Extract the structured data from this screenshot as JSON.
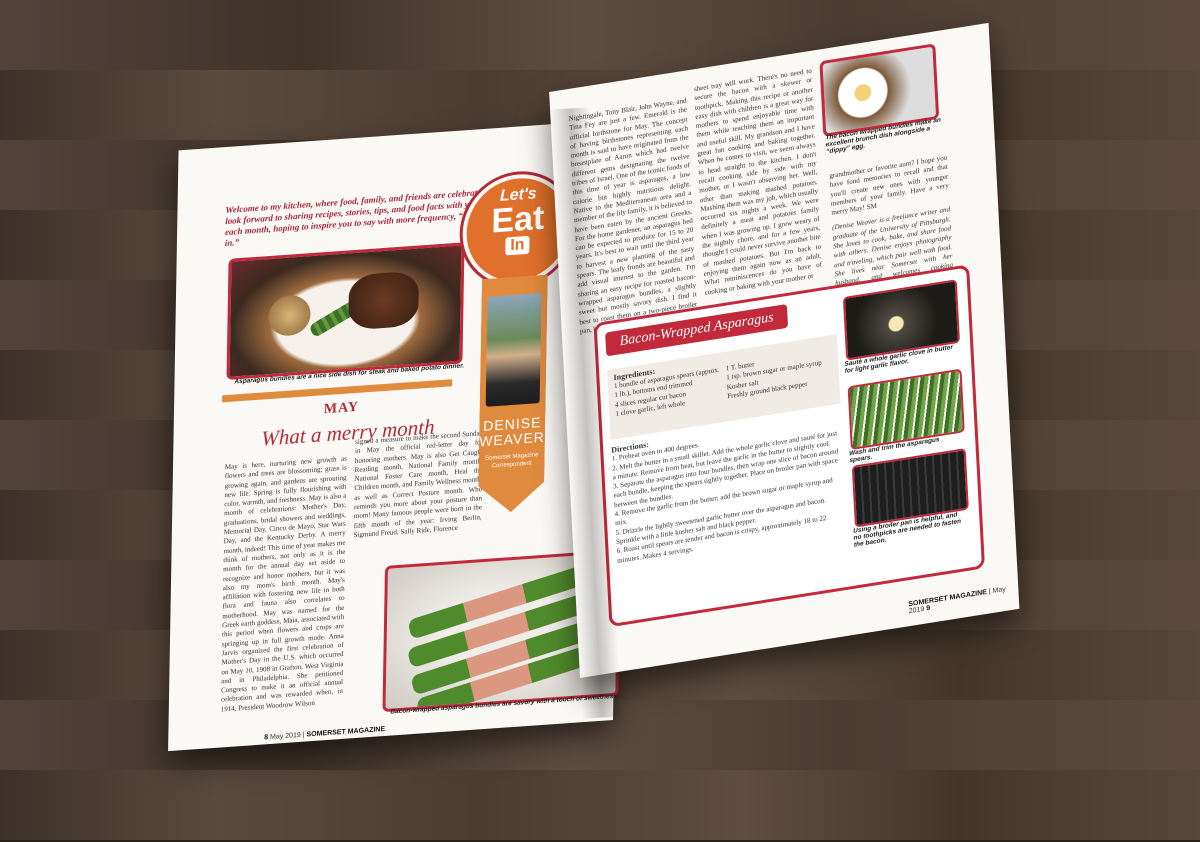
{
  "left_page": {
    "intro": "Welcome to my kitchen, where food, family, and friends are celebrated. I look forward to sharing recipes, stories, tips, and food facts with you each month, hoping to inspire you to say with more frequency, “Let’s eat in.”",
    "steak_caption": "Asparagus bundles are a nice side dish for steak and baked potato dinner.",
    "month": "MAY",
    "subtitle": "What a merry month",
    "col1": "May is here, nurturing new growth as flowers and trees are blossoming; grass is growing again, and gardens are sprouting new life. Spring is fully flourishing with color, warmth, and freshness. May is also a month of celebrations: Mother's Day, graduations, bridal showers and weddings, Memorial Day, Cinco de Mayo, Star Wars Day, and the Kentucky Derby. A merry month, indeed! This time of year makes me think of mothers, not only as it is the month for the annual day set aside to recognize and honor mothers, but it was also my mom's birth month. May's affiliation with fostering new life in both flora and fauna also correlates to motherhood. May was named for the Greek earth goddess, Maia, associated with this period when flowers and crops are springing up in full growth mode. Anna Jarvis organized the first celebration of Mother's Day in the U.S. which occurred on May 10, 1908 in Grafton, West Virginia and in Philadelphia. She petitioned Congress to make it an official annual celebration and was rewarded when, in 1914, President Woodrow Wilson",
    "col2": "signed a measure to make the second Sunday in May the official red-letter day for honoring mothers. May is also Get Caught Reading month, National Family month, National Foster Care month, Heal the Children month, and Family Wellness month, as well as Correct Posture month. Who reminds you more about your posture than mom! Many famous people were born in the fifth month of the year: Irving Berlin, Sigmund Freud, Sally Ride, Florence",
    "asparagus_caption": "Bacon-wrapped asparagus bundles are savory with a touch of sweetness.",
    "folio_number": "8",
    "folio_date": "May 2019",
    "folio_mag": "SOMERSET MAGAZINE"
  },
  "badge": {
    "lets": "Let's",
    "eat": "Eat",
    "in": "In"
  },
  "author": {
    "name": "DENISE WEAVER",
    "role": "Somerset Magazine Correspondent"
  },
  "right_page": {
    "col1": "Nightingale, Tony Blair, John Wayne, and Tina Fey are just a few. Emerald is the official birthstone for May. The concept of having birthstones representing each month is said to have originated from the breastplate of Aaron which had twelve different gems designating the twelve tribes of Israel. One of the iconic foods of this time of year is asparagus, a low calorie but highly nutritious delight. Native to the Mediterranean area and a member of the lily family, it is believed to have been eaten by the ancient Greeks. For the home gardener, an asparagus bed can be expected to produce for 15 to 20 years. It's best to wait until the third year to harvest a new planting of the tasty spears. The leafy fronds are beautiful and add visual interest to the garden. I'm sharing an easy recipe for roasted bacon-wrapped asparagus bundles, a slightly sweet but mostly savory dish. I find it best to roast them on a two-piece broiler pan, but a",
    "col2": "sheet tray will work. There's no need to secure the bacon with a skewer or toothpick. Making this recipe or another easy dish with children is a great way for mothers to spend enjoyable time with them while teaching them an important and useful skill. My grandson and I have great fun cooking and baking together. When he comes to visit, we seem always to head straight to the kitchen. I don't recall cooking side by side with my mother, or I wasn't observing her. Well, other than making mashed potatoes. Mashing them was my job, which usually occurred six nights a week. We were definitely a meat and potatoes family when I was growing up. I grew weary of the nightly chore, and for a few years, thought I could never survive another bite of mashed potatoes. But I'm back to enjoying them again now as an adult. What reminiscences do you have of cooking or baking with your mother or",
    "egg_caption": "The bacon wrapped bundles make an excellent brunch dish alongside a “dippy” egg.",
    "col3": "grandmother or favorite aunt? I hope you have fond memories to recall and that you'll create new ones with younger members of your family. Have a very merry May! SM",
    "bio": "(Denise Weaver is a freelance writer and graduate of the University of Pittsburgh. She loves to cook, bake, and share food with others. Denise enjoys photography and traveling, which pair well with food. She lives near Somerset with her husband, and welcomes cooking questions at quillshoppe@msn.com.)",
    "folio_mag": "SOMERSET MAGAZINE",
    "folio_date": "May 2019",
    "folio_number": "9"
  },
  "recipe": {
    "title": "Bacon-Wrapped Asparagus",
    "ingredients_head": "Ingredients:",
    "ingredients_a": [
      "1 bundle of asparagus spears (approx. 1 lb.), bottoms end trimmed",
      "4 slices regular cut bacon",
      "1 clove garlic, left whole"
    ],
    "ingredients_b": [
      "1 T. butter",
      "1 tsp. brown sugar or maple syrup",
      "Kosher salt",
      "Freshly ground black pepper"
    ],
    "directions_head": "Directions:",
    "directions": [
      "1. Preheat oven to 400 degrees.",
      "2. Melt the butter in a small skillet. Add the whole garlic clove and sauté for just a minute. Remove from heat, but leave the garlic in the butter to slightly cool.",
      "3. Separate the asparagus into four bundles, then wrap one slice of bacon around each bundle, keeping the spears tightly together. Place on broiler pan with space between the bundles.",
      "4. Remove the garlic from the butter; add the brown sugar or maple syrup and mix.",
      "5. Drizzle the lightly sweetened garlic butter over the asparagus and bacon. Sprinkle with a little kosher salt and black pepper.",
      "6. Roast until spears are tender and bacon is crispy, approximately 18 to 22 minutes. Makes 4 servings."
    ],
    "garlic_caption": "Sauté a whole garlic clove in butter for light garlic flavor.",
    "spears_caption": "Wash and trim the asparagus spears.",
    "pan_caption": "Using a broiler pan is helpful, and no toothpicks are needed to fasten the bacon."
  }
}
